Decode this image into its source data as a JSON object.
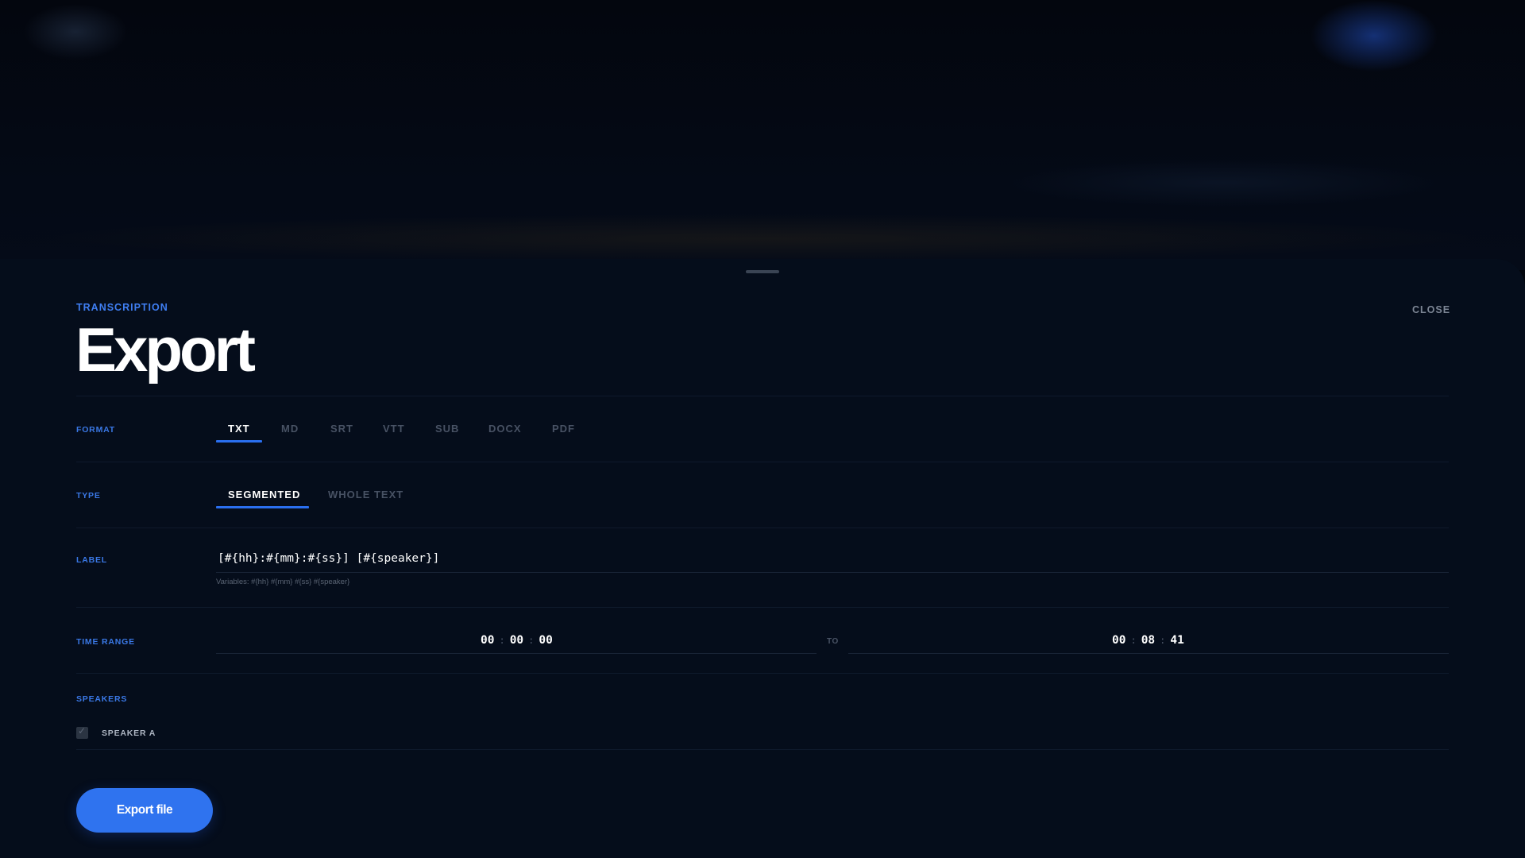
{
  "header": {
    "eyebrow": "TRANSCRIPTION",
    "title": "Export",
    "close_label": "CLOSE"
  },
  "format": {
    "label": "FORMAT",
    "options": [
      "TXT",
      "MD",
      "SRT",
      "VTT",
      "SUB",
      "DOCX",
      "PDF"
    ],
    "selected": "TXT"
  },
  "type": {
    "label": "TYPE",
    "options": [
      "SEGMENTED",
      "WHOLE TEXT"
    ],
    "selected": "SEGMENTED"
  },
  "label_field": {
    "label": "LABEL",
    "value": "[#{hh}:#{mm}:#{ss}] [#{speaker}]",
    "hint": "Variables: #{hh} #{mm} #{ss} #{speaker}"
  },
  "time_range": {
    "label": "TIME RANGE",
    "to_label": "TO",
    "start": {
      "hh": "00",
      "mm": "00",
      "ss": "00"
    },
    "end": {
      "hh": "00",
      "mm": "08",
      "ss": "41"
    },
    "separator": ":"
  },
  "speakers": {
    "label": "SPEAKERS",
    "items": [
      {
        "name": "SPEAKER A",
        "checked": true
      }
    ]
  },
  "actions": {
    "export_label": "Export file"
  },
  "colors": {
    "accent": "#2f73ef",
    "background": "#050d1b",
    "section_label": "#3a78e6"
  },
  "icons": {
    "checkbox_tick": "check-icon"
  }
}
